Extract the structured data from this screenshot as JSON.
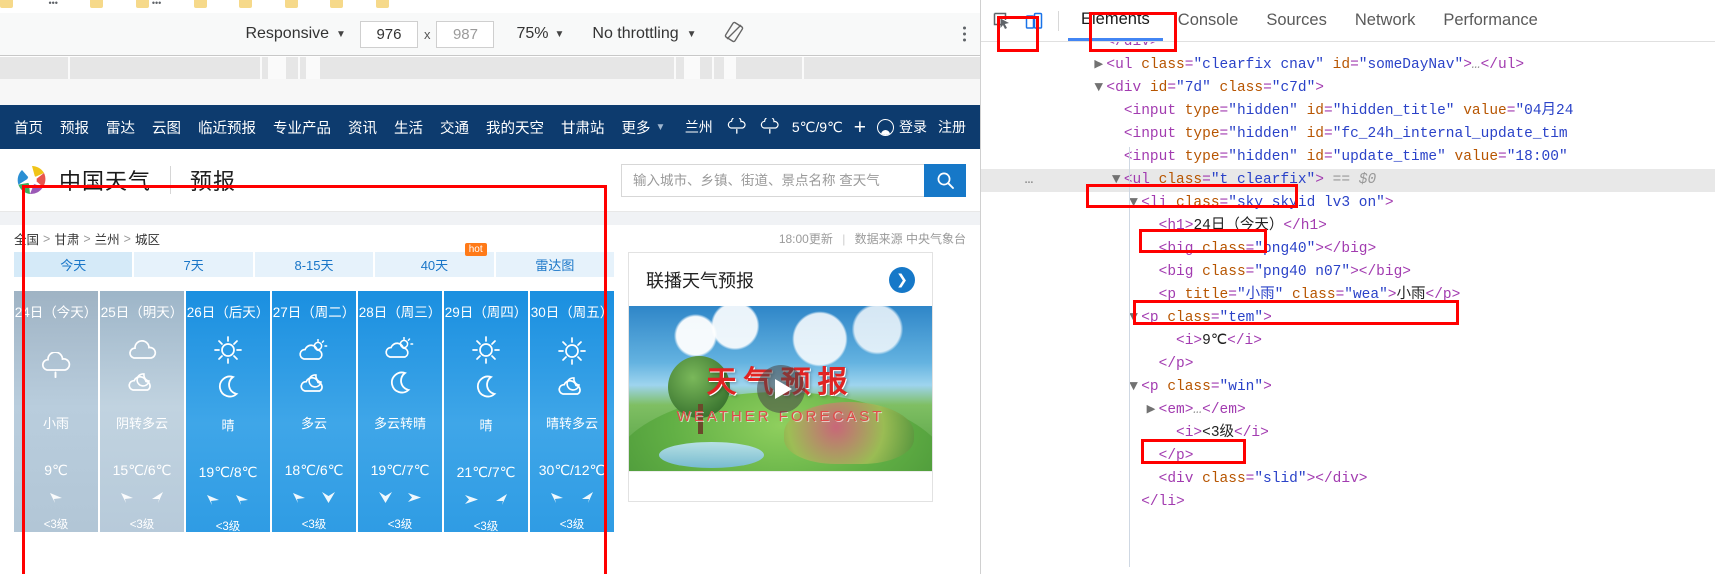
{
  "device_toolbar": {
    "device_select": "Responsive",
    "width": "976",
    "height": "987",
    "zoom": "75%",
    "throttling": "No throttling",
    "rotate_icon": "rotate-icon",
    "kebab_icon": "more-options-icon",
    "x_separator": "x"
  },
  "devtools": {
    "inspect_icon": "inspect-element-icon",
    "device_icon": "toggle-device-toolbar-icon",
    "tabs": [
      {
        "label": "Elements",
        "selected": true
      },
      {
        "label": "Console",
        "selected": false
      },
      {
        "label": "Sources",
        "selected": false
      },
      {
        "label": "Network",
        "selected": false
      },
      {
        "label": "Performance",
        "selected": false
      }
    ],
    "dom_lines": [
      {
        "indent": 3,
        "text": "</div>",
        "kind": "close",
        "twisty": ""
      },
      {
        "indent": 3,
        "twisty": "right",
        "segs": [
          {
            "t": "pun",
            "v": "<"
          },
          {
            "t": "tag",
            "v": "ul"
          },
          {
            "t": "attr",
            "v": " class"
          },
          {
            "t": "pun",
            "v": "="
          },
          {
            "t": "val",
            "v": "\"clearfix cnav\""
          },
          {
            "t": "attr",
            "v": " id"
          },
          {
            "t": "pun",
            "v": "="
          },
          {
            "t": "val",
            "v": "\"someDayNav\""
          },
          {
            "t": "pun",
            "v": ">"
          },
          {
            "t": "cmt",
            "v": "…"
          },
          {
            "t": "pun",
            "v": "</ul>"
          }
        ]
      },
      {
        "indent": 3,
        "twisty": "down",
        "segs": [
          {
            "t": "pun",
            "v": "<"
          },
          {
            "t": "tag",
            "v": "div"
          },
          {
            "t": "attr",
            "v": " id"
          },
          {
            "t": "pun",
            "v": "="
          },
          {
            "t": "val",
            "v": "\"7d\""
          },
          {
            "t": "attr",
            "v": " class"
          },
          {
            "t": "pun",
            "v": "="
          },
          {
            "t": "val",
            "v": "\"c7d\""
          },
          {
            "t": "pun",
            "v": ">"
          }
        ]
      },
      {
        "indent": 4,
        "twisty": "",
        "segs": [
          {
            "t": "pun",
            "v": "<"
          },
          {
            "t": "tag",
            "v": "input"
          },
          {
            "t": "attr",
            "v": " type"
          },
          {
            "t": "pun",
            "v": "="
          },
          {
            "t": "val",
            "v": "\"hidden\""
          },
          {
            "t": "attr",
            "v": " id"
          },
          {
            "t": "pun",
            "v": "="
          },
          {
            "t": "val",
            "v": "\"hidden_title\""
          },
          {
            "t": "attr",
            "v": " value"
          },
          {
            "t": "pun",
            "v": "="
          },
          {
            "t": "val",
            "v": "\"04月24"
          }
        ]
      },
      {
        "indent": 4,
        "twisty": "",
        "segs": [
          {
            "t": "pun",
            "v": "<"
          },
          {
            "t": "tag",
            "v": "input"
          },
          {
            "t": "attr",
            "v": " type"
          },
          {
            "t": "pun",
            "v": "="
          },
          {
            "t": "val",
            "v": "\"hidden\""
          },
          {
            "t": "attr",
            "v": " id"
          },
          {
            "t": "pun",
            "v": "="
          },
          {
            "t": "val",
            "v": "\"fc_24h_internal_update_tim"
          }
        ]
      },
      {
        "indent": 4,
        "twisty": "",
        "segs": [
          {
            "t": "pun",
            "v": "<"
          },
          {
            "t": "tag",
            "v": "input"
          },
          {
            "t": "attr",
            "v": " type"
          },
          {
            "t": "pun",
            "v": "="
          },
          {
            "t": "val",
            "v": "\"hidden\""
          },
          {
            "t": "attr",
            "v": " id"
          },
          {
            "t": "pun",
            "v": "="
          },
          {
            "t": "val",
            "v": "\"update_time\""
          },
          {
            "t": "attr",
            "v": " value"
          },
          {
            "t": "pun",
            "v": "="
          },
          {
            "t": "val",
            "v": "\"18:00\""
          }
        ]
      },
      {
        "indent": 4,
        "twisty": "down",
        "selected": true,
        "gutter": "…",
        "segs": [
          {
            "t": "pun",
            "v": "<"
          },
          {
            "t": "tag",
            "v": "ul"
          },
          {
            "t": "attr",
            "v": " class"
          },
          {
            "t": "pun",
            "v": "="
          },
          {
            "t": "val",
            "v": "\"t clearfix\""
          },
          {
            "t": "pun",
            "v": ">"
          },
          {
            "t": "cmt",
            "v": " == $0"
          }
        ]
      },
      {
        "indent": 5,
        "twisty": "down",
        "segs": [
          {
            "t": "pun",
            "v": "<"
          },
          {
            "t": "tag",
            "v": "li"
          },
          {
            "t": "attr",
            "v": " class"
          },
          {
            "t": "pun",
            "v": "="
          },
          {
            "t": "val",
            "v": "\"sky skyid lv3 on\""
          },
          {
            "t": "pun",
            "v": ">"
          }
        ]
      },
      {
        "indent": 6,
        "twisty": "",
        "segs": [
          {
            "t": "pun",
            "v": "<"
          },
          {
            "t": "tag",
            "v": "h1"
          },
          {
            "t": "pun",
            "v": ">"
          },
          {
            "t": "txt",
            "v": "24日（今天）"
          },
          {
            "t": "pun",
            "v": "</h1>"
          }
        ]
      },
      {
        "indent": 6,
        "twisty": "",
        "segs": [
          {
            "t": "pun",
            "v": "<"
          },
          {
            "t": "tag",
            "v": "big"
          },
          {
            "t": "attr",
            "v": " class"
          },
          {
            "t": "pun",
            "v": "="
          },
          {
            "t": "val",
            "v": "\"png40\""
          },
          {
            "t": "pun",
            "v": "></big>"
          }
        ]
      },
      {
        "indent": 6,
        "twisty": "",
        "segs": [
          {
            "t": "pun",
            "v": "<"
          },
          {
            "t": "tag",
            "v": "big"
          },
          {
            "t": "attr",
            "v": " class"
          },
          {
            "t": "pun",
            "v": "="
          },
          {
            "t": "val",
            "v": "\"png40 n07\""
          },
          {
            "t": "pun",
            "v": "></big>"
          }
        ]
      },
      {
        "indent": 6,
        "twisty": "",
        "segs": [
          {
            "t": "pun",
            "v": "<"
          },
          {
            "t": "tag",
            "v": "p"
          },
          {
            "t": "attr",
            "v": " title"
          },
          {
            "t": "pun",
            "v": "="
          },
          {
            "t": "val",
            "v": "\"小雨\""
          },
          {
            "t": "attr",
            "v": " class"
          },
          {
            "t": "pun",
            "v": "="
          },
          {
            "t": "val",
            "v": "\"wea\""
          },
          {
            "t": "pun",
            "v": ">"
          },
          {
            "t": "txt",
            "v": "小雨"
          },
          {
            "t": "pun",
            "v": "</p>"
          }
        ]
      },
      {
        "indent": 5,
        "twisty": "down",
        "segs": [
          {
            "t": "pun",
            "v": "<"
          },
          {
            "t": "tag",
            "v": "p"
          },
          {
            "t": "attr",
            "v": " class"
          },
          {
            "t": "pun",
            "v": "="
          },
          {
            "t": "val",
            "v": "\"tem\""
          },
          {
            "t": "pun",
            "v": ">"
          }
        ]
      },
      {
        "indent": 7,
        "twisty": "",
        "segs": [
          {
            "t": "pun",
            "v": "<"
          },
          {
            "t": "tag",
            "v": "i"
          },
          {
            "t": "pun",
            "v": ">"
          },
          {
            "t": "txt",
            "v": "9℃"
          },
          {
            "t": "pun",
            "v": "</i>"
          }
        ]
      },
      {
        "indent": 6,
        "twisty": "",
        "segs": [
          {
            "t": "pun",
            "v": "</p>"
          }
        ]
      },
      {
        "indent": 5,
        "twisty": "down",
        "segs": [
          {
            "t": "pun",
            "v": "<"
          },
          {
            "t": "tag",
            "v": "p"
          },
          {
            "t": "attr",
            "v": " class"
          },
          {
            "t": "pun",
            "v": "="
          },
          {
            "t": "val",
            "v": "\"win\""
          },
          {
            "t": "pun",
            "v": ">"
          }
        ]
      },
      {
        "indent": 6,
        "twisty": "right",
        "segs": [
          {
            "t": "pun",
            "v": "<"
          },
          {
            "t": "tag",
            "v": "em"
          },
          {
            "t": "pun",
            "v": ">"
          },
          {
            "t": "cmt",
            "v": "…"
          },
          {
            "t": "pun",
            "v": "</em>"
          }
        ]
      },
      {
        "indent": 7,
        "twisty": "",
        "segs": [
          {
            "t": "pun",
            "v": "<"
          },
          {
            "t": "tag",
            "v": "i"
          },
          {
            "t": "pun",
            "v": ">"
          },
          {
            "t": "txt",
            "v": "<3级"
          },
          {
            "t": "pun",
            "v": "</i>"
          }
        ]
      },
      {
        "indent": 6,
        "twisty": "",
        "segs": [
          {
            "t": "pun",
            "v": "</p>"
          }
        ]
      },
      {
        "indent": 6,
        "twisty": "",
        "segs": [
          {
            "t": "pun",
            "v": "<"
          },
          {
            "t": "tag",
            "v": "div"
          },
          {
            "t": "attr",
            "v": " class"
          },
          {
            "t": "pun",
            "v": "="
          },
          {
            "t": "val",
            "v": "\"slid\""
          },
          {
            "t": "pun",
            "v": "></div>"
          }
        ]
      },
      {
        "indent": 5,
        "twisty": "",
        "segs": [
          {
            "t": "pun",
            "v": "</li>"
          }
        ]
      }
    ]
  },
  "site": {
    "topnav": {
      "links": [
        "首页",
        "预报",
        "雷达",
        "云图",
        "临近预报",
        "专业产品",
        "资讯",
        "生活",
        "交通",
        "我的天空",
        "甘肃站"
      ],
      "more": "更多",
      "city": "兰州",
      "temp_range": "5℃/9℃",
      "add_icon": "plus-icon",
      "user_icon": "user-avatar-icon",
      "login": "登录",
      "register": "注册"
    },
    "header": {
      "brand": "中国天气",
      "page_kind": "预报",
      "logo_icon": "cma-weather-logo",
      "search_placeholder": "输入城市、乡镇、街道、景点名称 查天气",
      "search_value": "",
      "search_icon": "search-icon"
    },
    "breadcrumb": {
      "items": [
        "全国",
        "甘肃",
        "兰州",
        "城区"
      ],
      "separator": ">",
      "update_time": "18:00更新",
      "source": "数据来源 中央气象台"
    },
    "daytabs": [
      {
        "label": "今天",
        "active": true,
        "badge": ""
      },
      {
        "label": "7天",
        "active": false,
        "badge": ""
      },
      {
        "label": "8-15天",
        "active": false,
        "badge": ""
      },
      {
        "label": "40天",
        "active": false,
        "badge": "hot"
      },
      {
        "label": "雷达图",
        "active": false,
        "badge": ""
      }
    ],
    "forecast": [
      {
        "date": "24日（今天）",
        "weather": "小雨",
        "temp": "9℃",
        "icons": [
          "rain-icon"
        ],
        "wind_dirs": [
          "wind-arrow-sw"
        ],
        "wind_level": "<3级",
        "state": "past"
      },
      {
        "date": "25日（明天）",
        "weather": "阴转多云",
        "temp": "15℃/6℃",
        "icons": [
          "overcast-icon",
          "cloudy-night-icon"
        ],
        "wind_dirs": [
          "wind-arrow-sw",
          "wind-arrow-ne"
        ],
        "wind_level": "<3级",
        "state": "past2"
      },
      {
        "date": "26日（后天）",
        "weather": "晴",
        "temp": "19℃/8℃",
        "icons": [
          "sun-icon",
          "moon-icon"
        ],
        "wind_dirs": [
          "wind-arrow-sw",
          "wind-arrow-sw"
        ],
        "wind_level": "<3级",
        "state": "future"
      },
      {
        "date": "27日（周二）",
        "weather": "多云",
        "temp": "18℃/6℃",
        "icons": [
          "partly-cloudy-day-icon",
          "cloudy-night-icon"
        ],
        "wind_dirs": [
          "wind-arrow-sw",
          "wind-arrow-down"
        ],
        "wind_level": "<3级",
        "state": "future"
      },
      {
        "date": "28日（周三）",
        "weather": "多云转晴",
        "temp": "19℃/7℃",
        "icons": [
          "partly-cloudy-day-icon",
          "moon-icon"
        ],
        "wind_dirs": [
          "wind-arrow-down",
          "wind-arrow-east"
        ],
        "wind_level": "<3级",
        "state": "future"
      },
      {
        "date": "29日（周四）",
        "weather": "晴",
        "temp": "21℃/7℃",
        "icons": [
          "sun-icon",
          "moon-icon"
        ],
        "wind_dirs": [
          "wind-arrow-east",
          "wind-arrow-ne"
        ],
        "wind_level": "<3级",
        "state": "future"
      },
      {
        "date": "30日（周五）",
        "weather": "晴转多云",
        "temp": "30℃/12℃",
        "icons": [
          "sun-icon",
          "cloudy-night-icon"
        ],
        "wind_dirs": [
          "wind-arrow-sw",
          "wind-arrow-ne"
        ],
        "wind_level": "<3级",
        "state": "future"
      }
    ],
    "video": {
      "title": "联播天气预报",
      "arrow_icon": "chevron-right-circle-icon",
      "thumb_title": "天气预报",
      "thumb_subtitle": "WEATHER FORECAST",
      "play_icon": "play-button-icon"
    }
  },
  "colors": {
    "nav_blue": "#0d3b6e",
    "accent_blue": "#1678c8",
    "future_card": "#2f9ce4",
    "past_card": "#b0c4d4",
    "annotation_red": "#ff0000",
    "hot_orange": "#ff7a18",
    "devtools_selected": "#4285f4"
  }
}
